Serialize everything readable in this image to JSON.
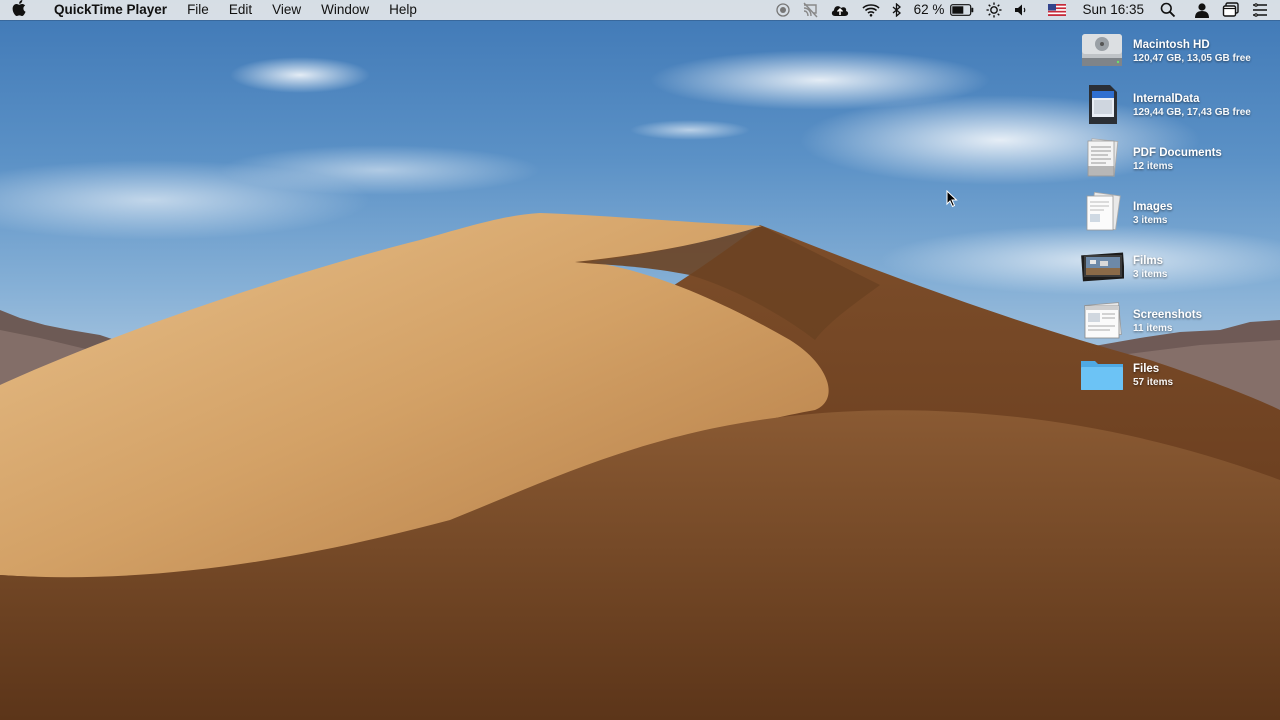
{
  "menubar": {
    "apple_icon": "apple-logo-icon",
    "app_name": "QuickTime Player",
    "menus": [
      "File",
      "Edit",
      "View",
      "Window",
      "Help"
    ],
    "battery_percent": "62 %",
    "clock": "Sun 16:35",
    "status_icons": [
      "screen-record-icon",
      "airplay-off-icon",
      "cloud-upload-icon",
      "wifi-icon",
      "bluetooth-icon",
      "battery-icon",
      "brightness-icon",
      "volume-icon",
      "us-flag-icon",
      "spotlight-search-icon",
      "user-icon",
      "mission-control-icon",
      "control-menu-icon"
    ]
  },
  "desktop_items": [
    {
      "name": "Macintosh HD",
      "sub": "120,47 GB, 13,05 GB free",
      "icon": "hard-drive-icon"
    },
    {
      "name": "InternalData",
      "sub": "129,44 GB, 17,43 GB free",
      "icon": "sd-card-icon"
    },
    {
      "name": "PDF Documents",
      "sub": "12 items",
      "icon": "pdf-stack-icon"
    },
    {
      "name": "Images",
      "sub": "3 items",
      "icon": "images-stack-icon"
    },
    {
      "name": "Films",
      "sub": "3 items",
      "icon": "films-stack-icon"
    },
    {
      "name": "Screenshots",
      "sub": "11 items",
      "icon": "screenshots-stack-icon"
    },
    {
      "name": "Files",
      "sub": "57 items",
      "icon": "folder-icon"
    }
  ],
  "colors": {
    "menubar_bg": "#ececec",
    "sky": "#5b91c6",
    "dune_light": "#d9a866",
    "dune_dark": "#7a4a25",
    "folder_blue": "#5bb8ee"
  }
}
